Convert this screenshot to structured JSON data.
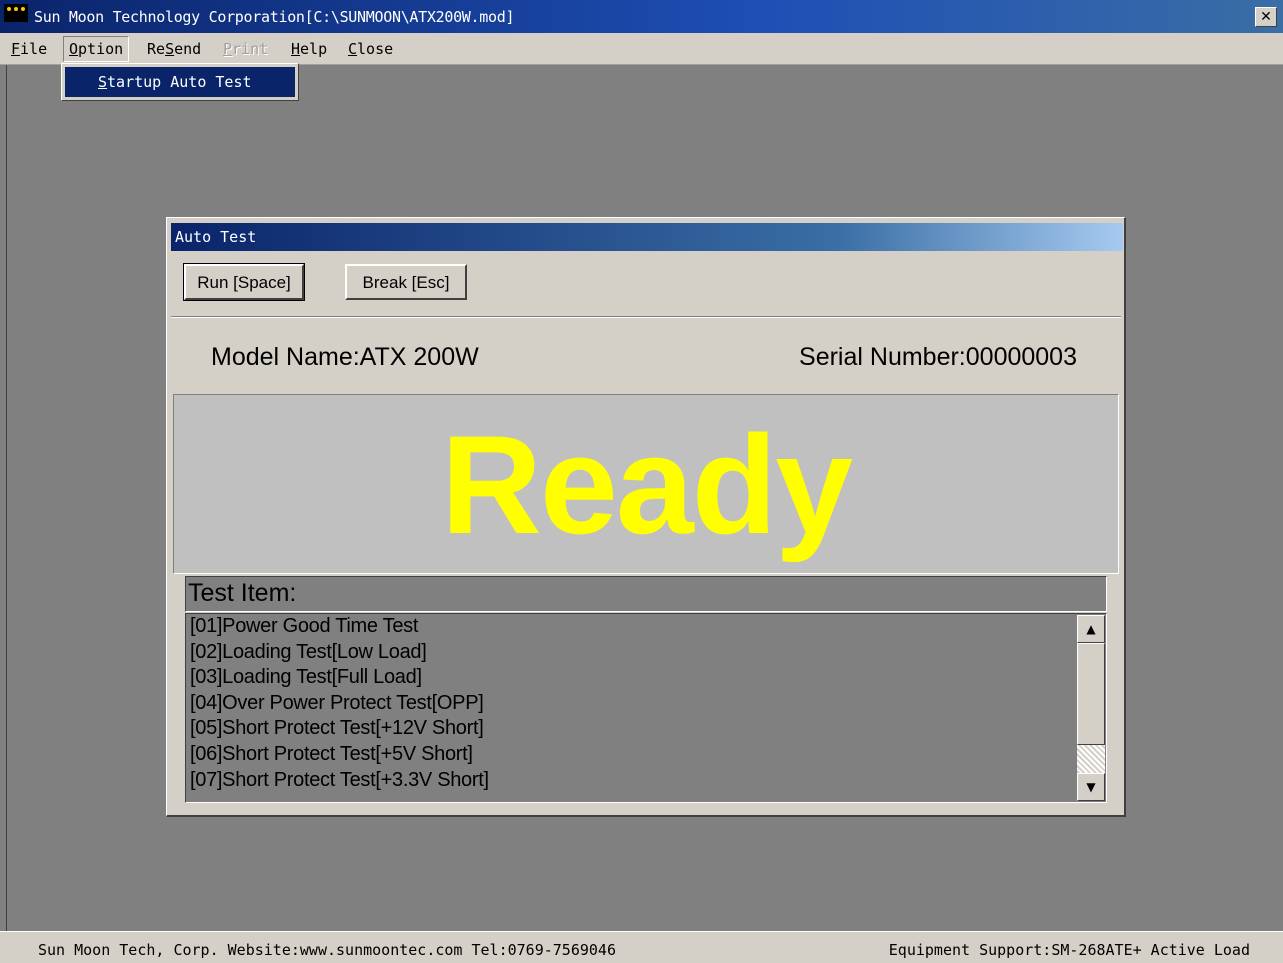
{
  "window": {
    "title": "Sun Moon Technology Corporation[C:\\SUNMOON\\ATX200W.mod]",
    "close_symbol": "✕"
  },
  "menu": {
    "file": {
      "before": "",
      "key": "F",
      "after": "ile"
    },
    "option": {
      "before": "",
      "key": "O",
      "after": "ption"
    },
    "resend": {
      "before": "Re",
      "key": "S",
      "after": "end"
    },
    "print": {
      "before": "",
      "key": "P",
      "after": "rint"
    },
    "help": {
      "before": "",
      "key": "H",
      "after": "elp"
    },
    "close": {
      "before": "",
      "key": "C",
      "after": "lose"
    },
    "dropdown": {
      "key": "S",
      "after": "tartup Auto Test"
    }
  },
  "dialog": {
    "title": "Auto Test",
    "run_button": "Run [Space]",
    "break_button": "Break [Esc]",
    "model_name": "Model Name:ATX 200W",
    "serial_number": "Serial Number:00000003",
    "status": "Ready",
    "status_color": "#ffff00",
    "test_item_label": "Test Item:",
    "test_items": [
      "[01]Power Good Time Test",
      "[02]Loading Test[Low Load]",
      "[03]Loading Test[Full Load]",
      "[04]Over Power Protect Test[OPP]",
      "[05]Short Protect Test[+12V Short]",
      "[06]Short Protect Test[+5V Short]",
      "[07]Short Protect Test[+3.3V Short]"
    ]
  },
  "statusbar": {
    "left": "Sun Moon Tech, Corp. Website:www.sunmoontec.com Tel:0769-7569046",
    "right": "Equipment Support:SM-268ATE+ Active Load"
  },
  "colors": {
    "titlebar": "#0a246a",
    "face": "#d4d0c8",
    "workspace": "#808080",
    "ready_text": "#ffff00"
  }
}
